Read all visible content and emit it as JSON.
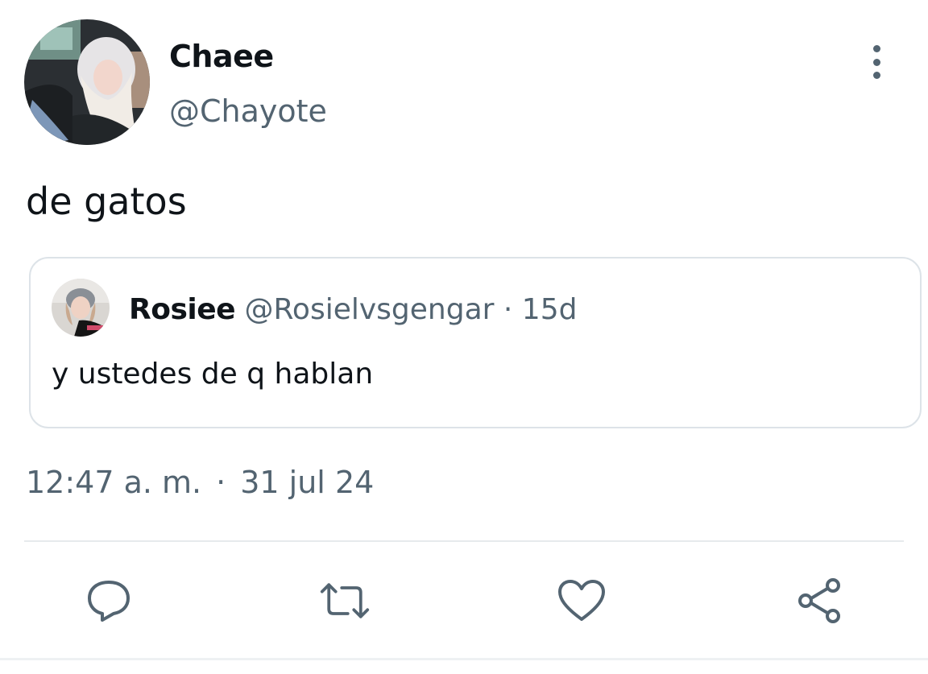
{
  "tweet": {
    "author": {
      "display_name": "Chaee",
      "handle": "@Chayote"
    },
    "text": "de gatos",
    "time": "12:47 a. m.",
    "separator": "·",
    "date": "31 jul 24"
  },
  "quoted_tweet": {
    "author_name": "Rosiee",
    "author_handle": "@Rosielvsgengar",
    "separator": "·",
    "relative_time": "15d",
    "text": "y ustedes de q hablan"
  },
  "actions": [
    {
      "icon": "reply-icon"
    },
    {
      "icon": "retweet-icon"
    },
    {
      "icon": "like-icon"
    },
    {
      "icon": "share-icon"
    }
  ],
  "colors": {
    "text_primary": "#0f1419",
    "text_secondary": "#536471",
    "border": "#dde3e8",
    "icon": "#536471"
  }
}
